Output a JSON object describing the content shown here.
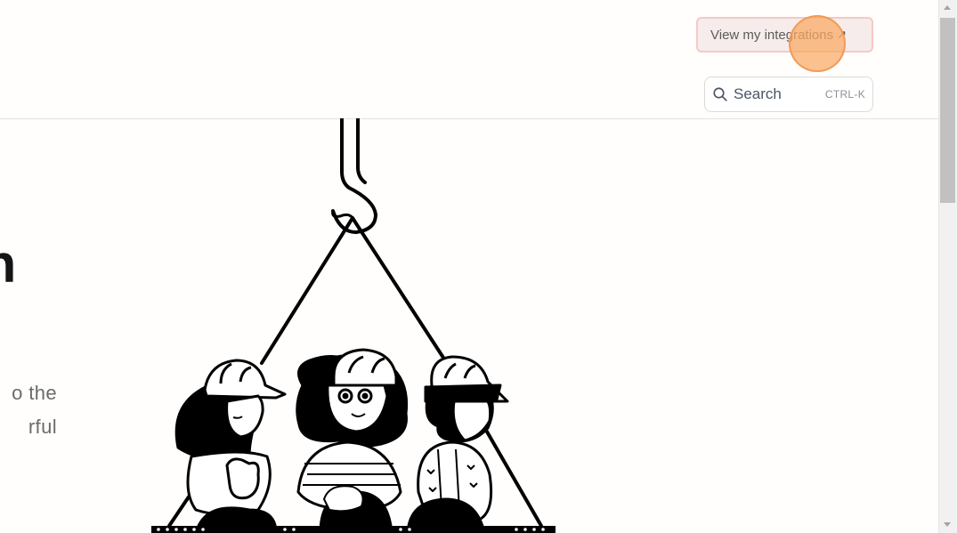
{
  "header": {
    "integrations_label": "View my integrations",
    "integrations_arrow": "↗",
    "search_label": "Search",
    "search_shortcut": "CTRL-K"
  },
  "hero": {
    "title_visible": "ith",
    "description_lines": [
      "o the",
      "rful"
    ]
  },
  "icons": {
    "search": "search-icon",
    "external": "external-arrow-icon"
  },
  "colors": {
    "accent_border": "#f5c9c6",
    "click_indicator": "#f9a962"
  }
}
